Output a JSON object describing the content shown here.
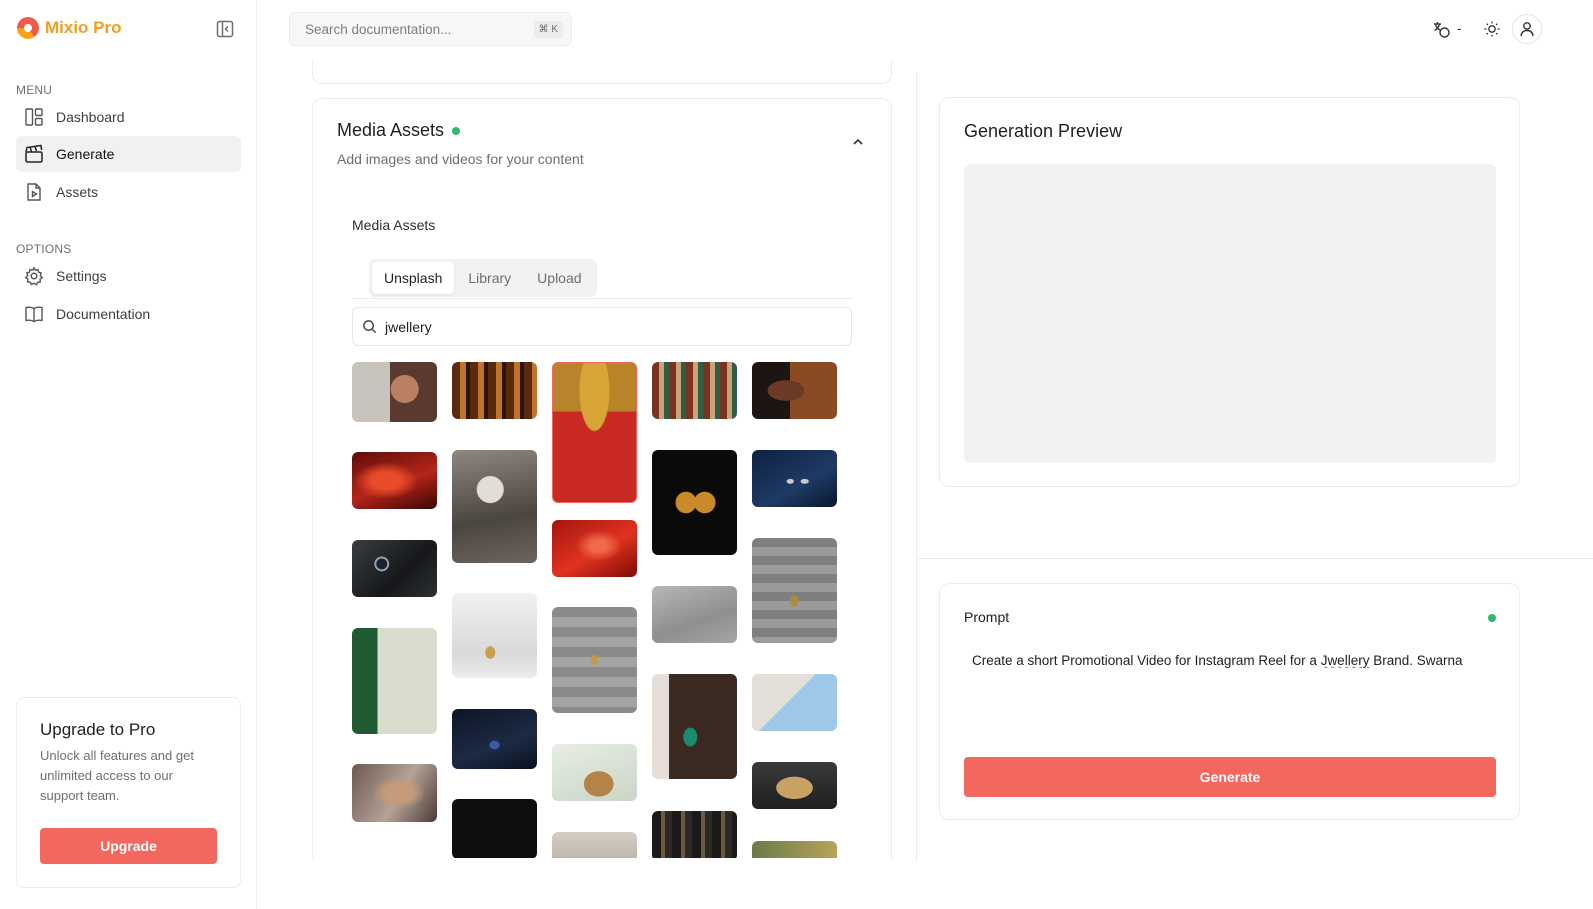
{
  "app": {
    "name": "Mixio Pro"
  },
  "topbar": {
    "search_placeholder": "Search documentation...",
    "search_shortcut": "⌘ K",
    "language_value": "-"
  },
  "sidebar": {
    "menu_heading": "MENU",
    "menu_items": [
      {
        "label": "Dashboard",
        "icon": "dashboard-icon",
        "active": false
      },
      {
        "label": "Generate",
        "icon": "clapperboard-icon",
        "active": true
      },
      {
        "label": "Assets",
        "icon": "file-play-icon",
        "active": false
      }
    ],
    "options_heading": "OPTIONS",
    "option_items": [
      {
        "label": "Settings",
        "icon": "gear-icon"
      },
      {
        "label": "Documentation",
        "icon": "book-icon"
      }
    ],
    "upgrade": {
      "title": "Upgrade to Pro",
      "description": "Unlock all features and get unlimited access to our support team.",
      "button": "Upgrade"
    }
  },
  "media": {
    "title": "Media Assets",
    "subtitle": "Add images and videos for your content",
    "section_label": "Media Assets",
    "tabs": [
      "Unsplash",
      "Library",
      "Upload"
    ],
    "active_tab": "Unsplash",
    "search_value": "jwellery",
    "accent_dot_color": "#2fb86a"
  },
  "preview": {
    "title": "Generation Preview"
  },
  "prompt": {
    "label": "Prompt",
    "text_before": "Create a short Promotional Video for Instagram Reel for a ",
    "text_misspelled": "Jwellery",
    "text_after": " Brand. Swarna",
    "generate_button": "Generate"
  },
  "colors": {
    "accent": "#f4675e",
    "brand": "#f0a020",
    "status_green": "#2fb86a"
  }
}
